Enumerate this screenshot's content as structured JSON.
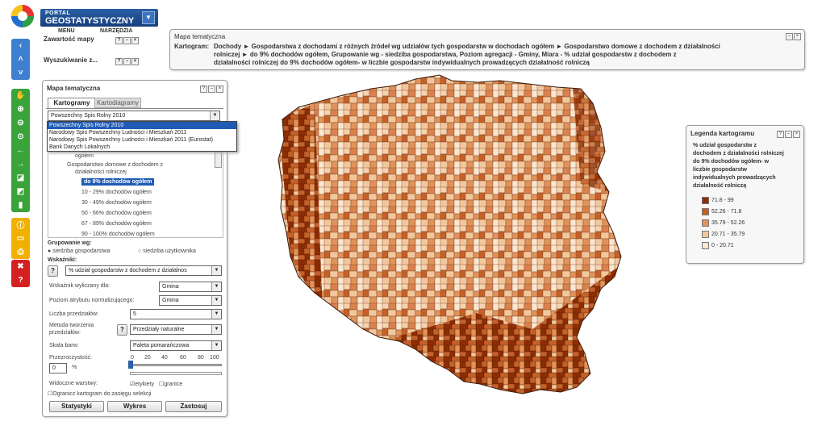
{
  "header": {
    "portal_small": "PORTAL",
    "portal_big": "GEOSTATYSTYCZNY",
    "menu": "MENU",
    "tools": "NARZĘDZIA"
  },
  "side_panels": {
    "map_contents": "Zawartość mapy",
    "search": "Wyszukiwanie z..."
  },
  "thematic_panel": {
    "title": "Mapa tematyczna",
    "tabs": [
      "Kartogramy",
      "Kartodiagramy"
    ],
    "source_selected": "Powszechny Spis Rolny 2010",
    "source_options": [
      "Powszechny Spis Rolny 2010",
      "Narodowy Spis Powszechny Ludności i Mieszkań 2011",
      "Narodowy Spis Powszechny Ludności i Mieszkań 2011 (Eurostat)",
      "Bank Danych Lokalnych"
    ],
    "tree": [
      "ogółem",
      "Gospodarstwo domowe z dochodem z",
      "działalności rolniczej",
      "do 9% dochodów ogółem",
      "10 - 29% dochodów ogółem",
      "30 - 49% dochodów ogółem",
      "50 - 66% dochodów ogółem",
      "67 - 89% dochodów ogółem",
      "90 - 100% dochodów ogółem"
    ],
    "grouping_label": "Grupowanie wg:",
    "grouping_options": [
      "siedziba gospodarstwa",
      "siedziba użytkownika"
    ],
    "indicators_label": "Wskaźniki:",
    "indicator_value": "% udział gospodarstw z dochodem z działalnos",
    "calc_for_label": "Wskaźnik wyliczany dla:",
    "calc_for_value": "Gmina",
    "norm_label": "Poziom atrybutu normalizującego:",
    "norm_value": "Gmina",
    "intervals_label": "Liczba przedziałów:",
    "intervals_value": "5",
    "method_label1": "Metoda tworzenia",
    "method_label2": "przedziałów:",
    "method_value": "Przedziały naturalne",
    "scale_label": "Skala barw:",
    "scale_value": "Paleta pomarańczowa",
    "transparency_label": "Przezroczystość:",
    "transparency_value": "0",
    "percent": "%",
    "ticks": [
      "0",
      "20",
      "40",
      "60",
      "80",
      "100"
    ],
    "layers_label": "Widoczne warstwy:",
    "layer_labels": "etykiety",
    "layer_borders": "granice",
    "limit_label": "Ogranicz kartogram do zasięgu selekcji",
    "buttons": [
      "Statystyki",
      "Wykres",
      "Zastosuj"
    ],
    "help": "?"
  },
  "map_title": {
    "title": "Mapa tematyczna",
    "prefix": "Kartogram:",
    "line1": "Dochody ► Gospodarstwa z dochodami z różnych źródeł wg udziałów tych gospodarstw w dochodach ogółem ► Gospodarstwo domowe z dochodem z działalności",
    "line2": "rolniczej ► do 9% dochodów ogółem, Grupowanie wg - siedziba gospodarstwa, Poziom agregacji - Gminy, Miara - % udział gospodarstw z dochodem z",
    "line3": "działalności rolniczej do 9% dochodów ogółem- w liczbie gospodarstw indywidualnych prowadzących działalność rolniczą"
  },
  "legend": {
    "title": "Legenda kartogramu",
    "desc": [
      "% udział gospodarstw z",
      "dochodem z działalności rolniczej",
      "do 9% dochodów ogółem- w",
      "liczbie gospodarstw",
      "indywidualnych prowadzących",
      "działalność rolniczą"
    ],
    "classes": [
      {
        "range": "71.8 - 99",
        "color": "#8c2d04"
      },
      {
        "range": "52.26 - 71.8",
        "color": "#c4612a"
      },
      {
        "range": "35.79 - 52.26",
        "color": "#e0935a"
      },
      {
        "range": "20.71 - 35.79",
        "color": "#f3c79c"
      },
      {
        "range": "0 - 20.71",
        "color": "#fbe6d0"
      }
    ]
  },
  "colors": {
    "accent": "#2a5fa4",
    "selected": "#1f5bb5"
  }
}
